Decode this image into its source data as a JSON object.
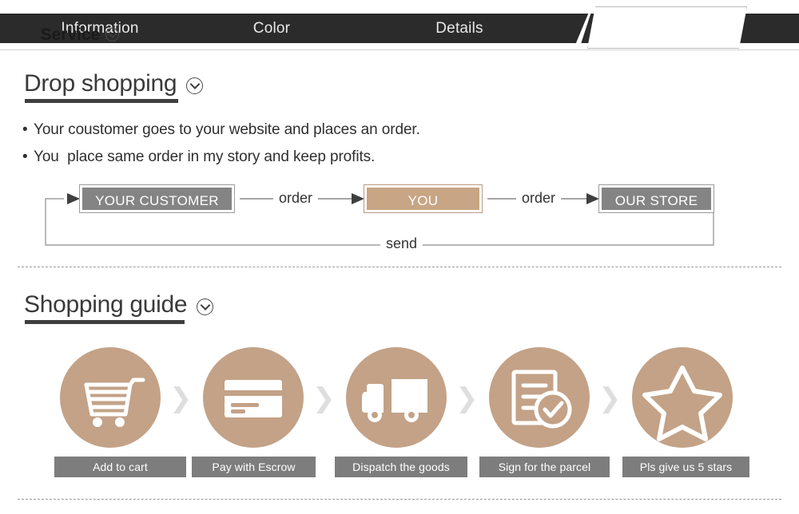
{
  "tabbar": {
    "tabs": [
      {
        "label": "Information",
        "active": false
      },
      {
        "label": "Color",
        "active": false
      },
      {
        "label": "Details",
        "active": false
      }
    ],
    "active_tab": {
      "label": "Service",
      "icon": "chevron-down-circle-icon"
    },
    "bar_color": "#2b2b2b",
    "text_color": "#e9e9e9"
  },
  "drop_shopping": {
    "heading": "Drop shopping",
    "heading_icon": "chevron-down-circle-icon",
    "bullets": [
      "Your coustomer goes to your website and places an order.",
      "You  place same order in my story and keep profits."
    ],
    "bullet_marker": "•",
    "flow": {
      "boxes": [
        {
          "label": "YOUR CUSTOMER",
          "style": "gray",
          "color": "#848484"
        },
        {
          "label": "YOU",
          "style": "tan",
          "color": "#c8a584"
        },
        {
          "label": "OUR STORE",
          "style": "gray",
          "color": "#848484"
        }
      ],
      "arrow_labels": [
        "order",
        "order"
      ],
      "return_label": "send"
    }
  },
  "shopping_guide": {
    "heading": "Shopping guide",
    "heading_icon": "chevron-down-circle-icon",
    "separator_glyph": "❯",
    "circle_color": "#c3a287",
    "label_color": "#7d7d7d",
    "steps": [
      {
        "label": "Add to cart",
        "icon": "shopping-cart-icon"
      },
      {
        "label": "Pay with Escrow",
        "icon": "credit-card-icon"
      },
      {
        "label": "Dispatch the goods",
        "icon": "delivery-truck-icon"
      },
      {
        "label": "Sign for the parcel",
        "icon": "document-check-icon"
      },
      {
        "label": "Pls give us 5 stars",
        "icon": "star-outline-icon"
      }
    ]
  }
}
